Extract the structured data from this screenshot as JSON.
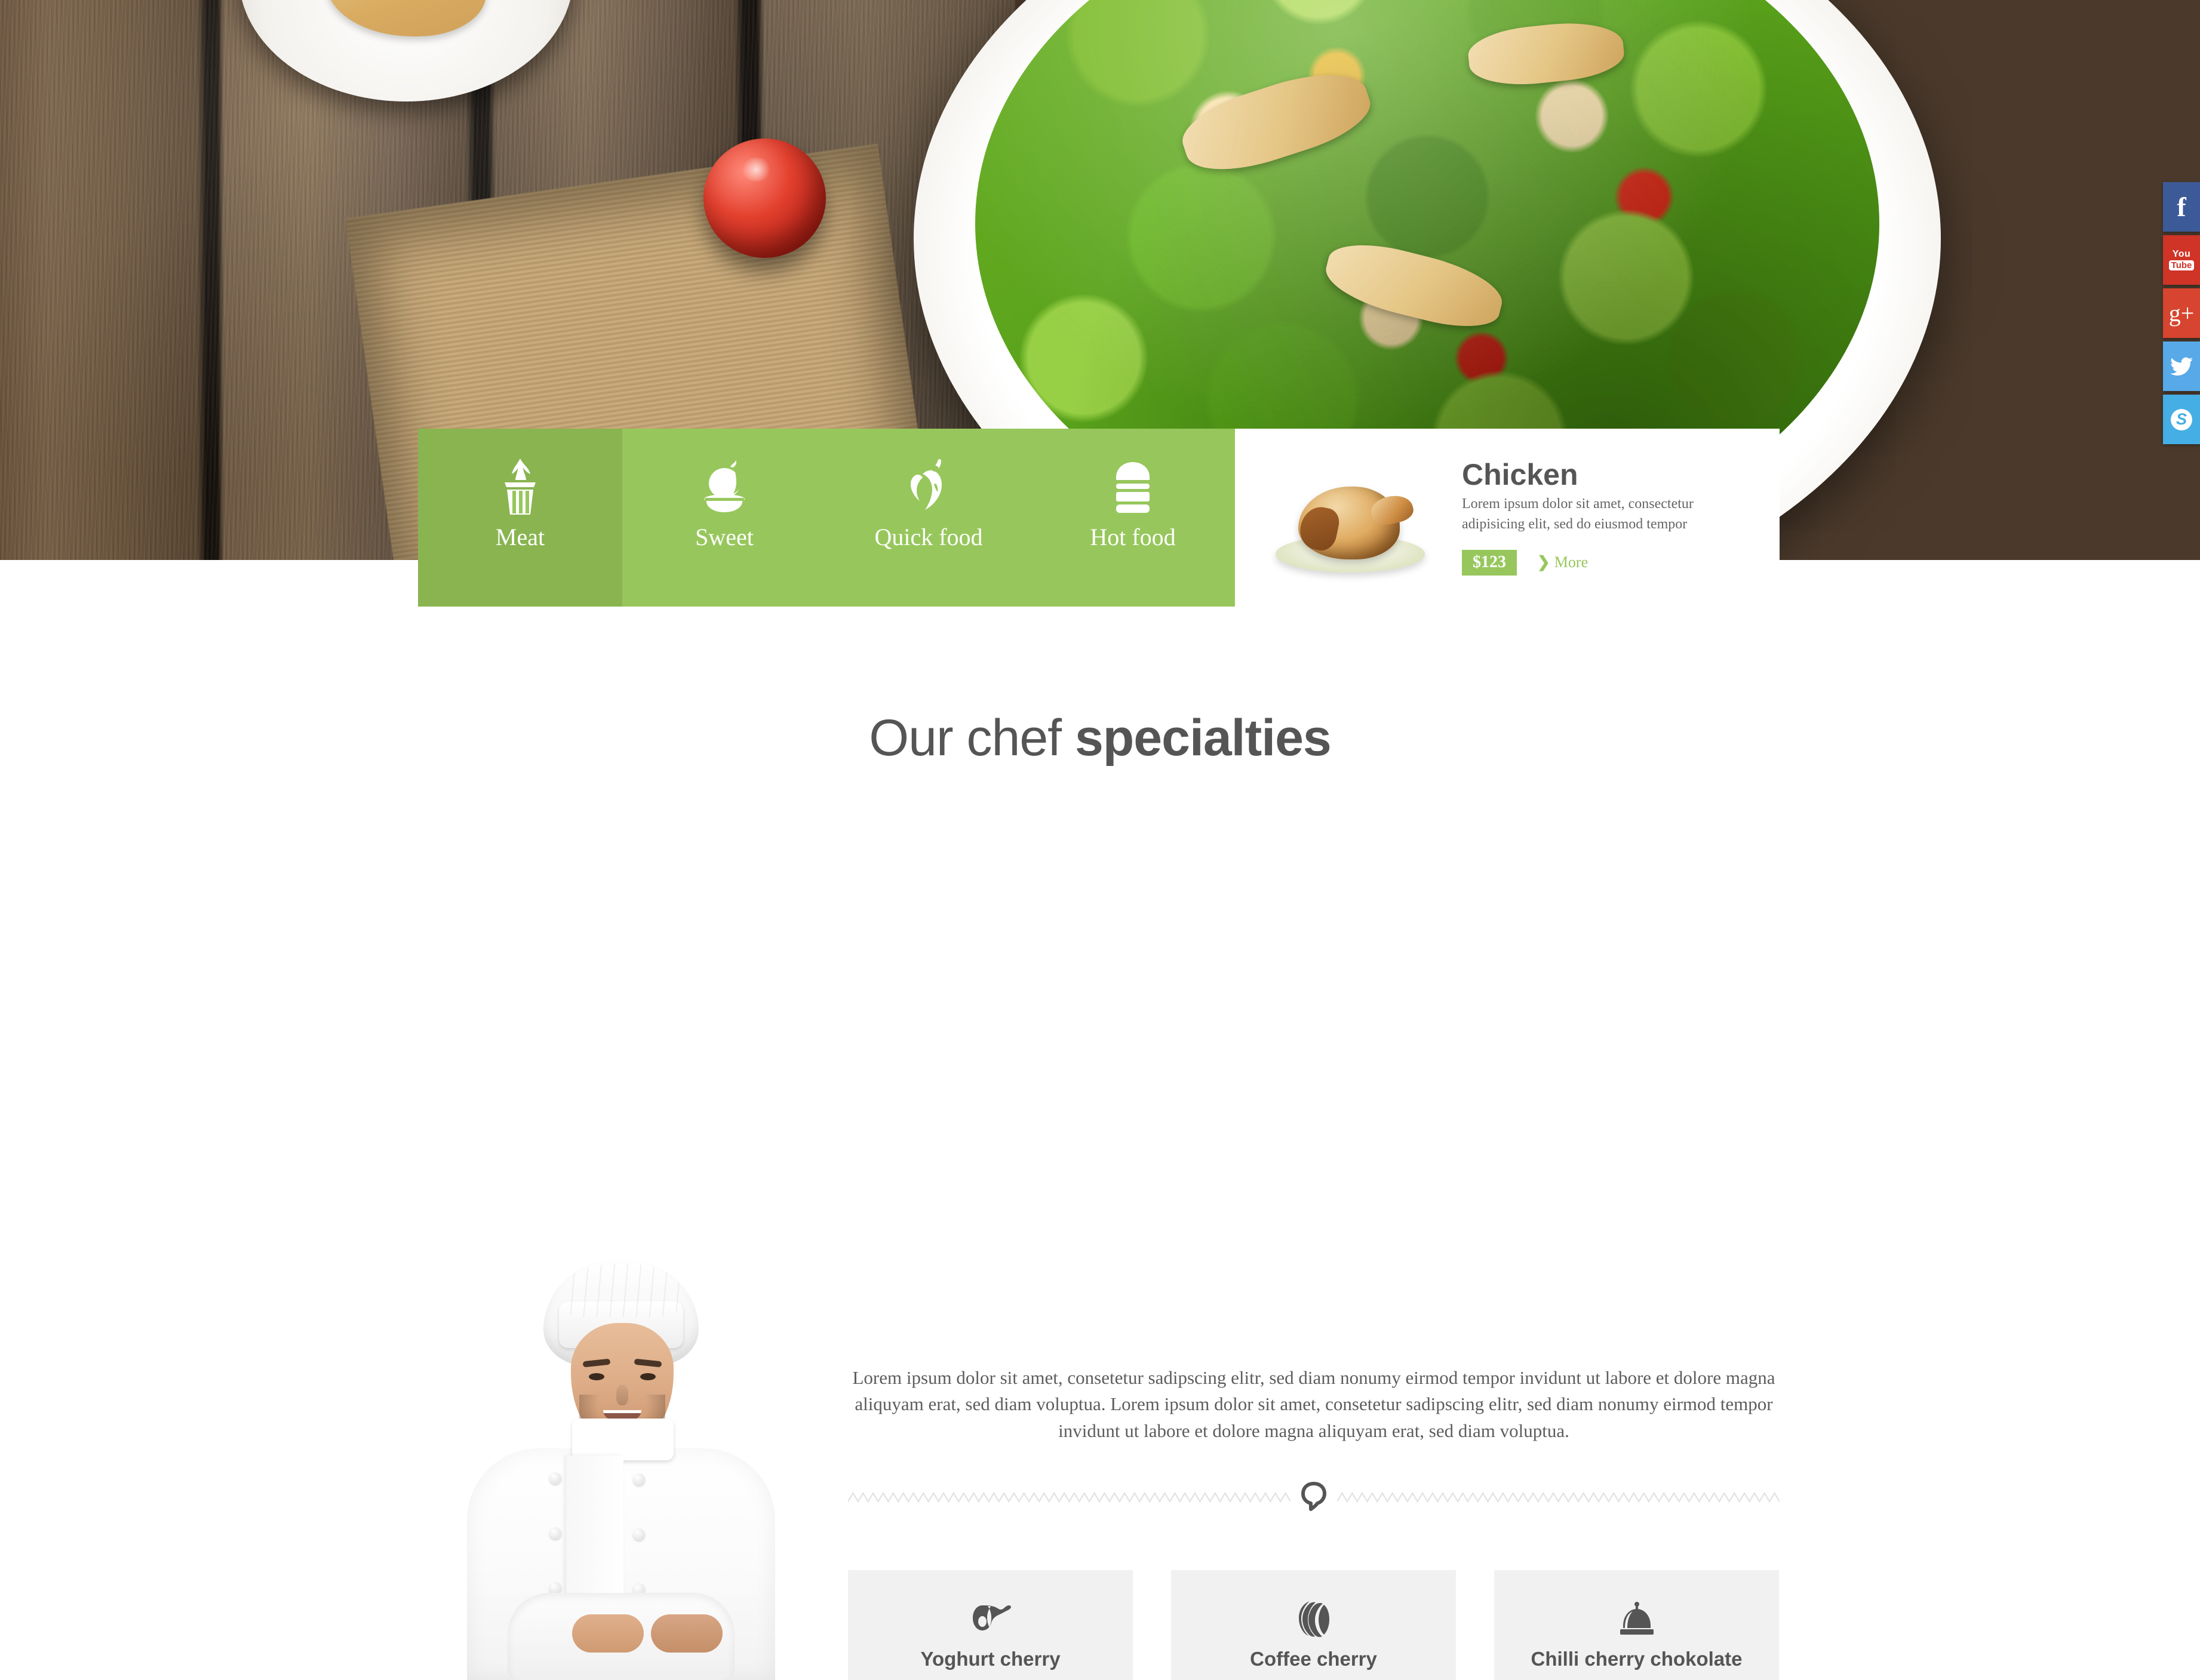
{
  "hero": {
    "alt": "salad-bowl-on-wooden-table"
  },
  "social": {
    "items": [
      {
        "name": "facebook",
        "glyph": "f",
        "color": "#3d5a98"
      },
      {
        "name": "youtube",
        "line1": "You",
        "line2": "Tube",
        "color": "#cf3427"
      },
      {
        "name": "googleplus",
        "glyph": "g+",
        "color": "#d7442f"
      },
      {
        "name": "twitter",
        "glyph": "bird",
        "color": "#57a9e8"
      },
      {
        "name": "skype",
        "glyph": "S",
        "color": "#45aee4"
      }
    ]
  },
  "menu": {
    "active_index": 0,
    "green": "#97c75c",
    "green_active": "#89b450",
    "items": [
      {
        "label": "Meat",
        "icon": "cupcake-icon"
      },
      {
        "label": "Sweet",
        "icon": "roast-chicken-icon"
      },
      {
        "label": "Quick food",
        "icon": "chili-pepper-icon"
      },
      {
        "label": "Hot food",
        "icon": "burger-icon"
      }
    ]
  },
  "featured": {
    "title": "Chicken",
    "description": "Lorem ipsum dolor sit amet, consectetur adipisicing elit, sed do eiusmod tempor",
    "price": "$123",
    "more_label": "More",
    "more_chevron": "❯",
    "thumb_alt": "roast-chicken-on-plate"
  },
  "specialties": {
    "heading_light": "Our chef ",
    "heading_bold": "specialties",
    "paragraph": "Lorem ipsum dolor sit amet, consetetur sadipscing elitr, sed diam nonumy eirmod tempor invidunt ut labore et dolore magna aliquyam erat, sed diam voluptua. Lorem ipsum dolor sit amet, consetetur sadipscing elitr, sed diam nonumy eirmod tempor invidunt ut labore et dolore magna aliquyam erat, sed diam voluptua.",
    "chef_alt": "smiling-chef-portrait",
    "divider_icon": "speech-bubble-icon",
    "cards": [
      {
        "name": "Yoghurt cherry",
        "icon": "ham-icon"
      },
      {
        "name": "Coffee cherry",
        "icon": "coffee-bean-icon"
      },
      {
        "name": "Chilli cherry chokolate",
        "icon": "cloche-icon"
      }
    ]
  }
}
